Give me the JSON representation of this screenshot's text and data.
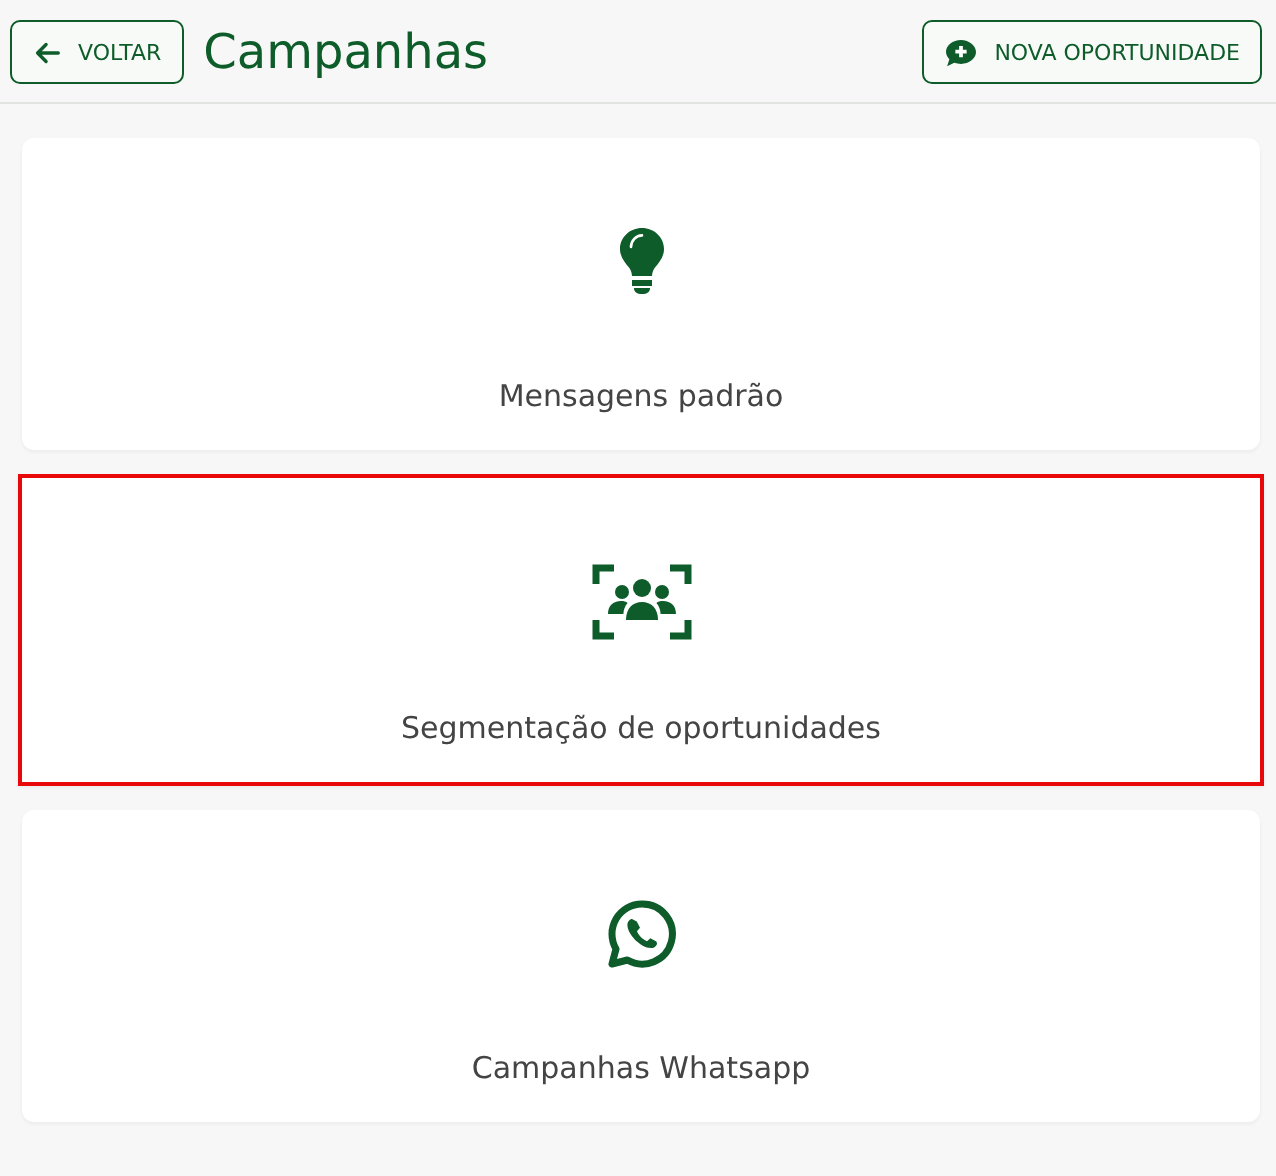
{
  "header": {
    "back_button": "VOLTAR",
    "title": "Campanhas",
    "action_button": "NOVA OPORTUNIDADE"
  },
  "cards": [
    {
      "kind": "bulb",
      "label": "Mensagens padrão",
      "selected": false
    },
    {
      "kind": "group",
      "label": "Segmentação de oportunidades",
      "selected": true
    },
    {
      "kind": "whatsapp",
      "label": "Campanhas Whatsapp",
      "selected": false
    }
  ]
}
